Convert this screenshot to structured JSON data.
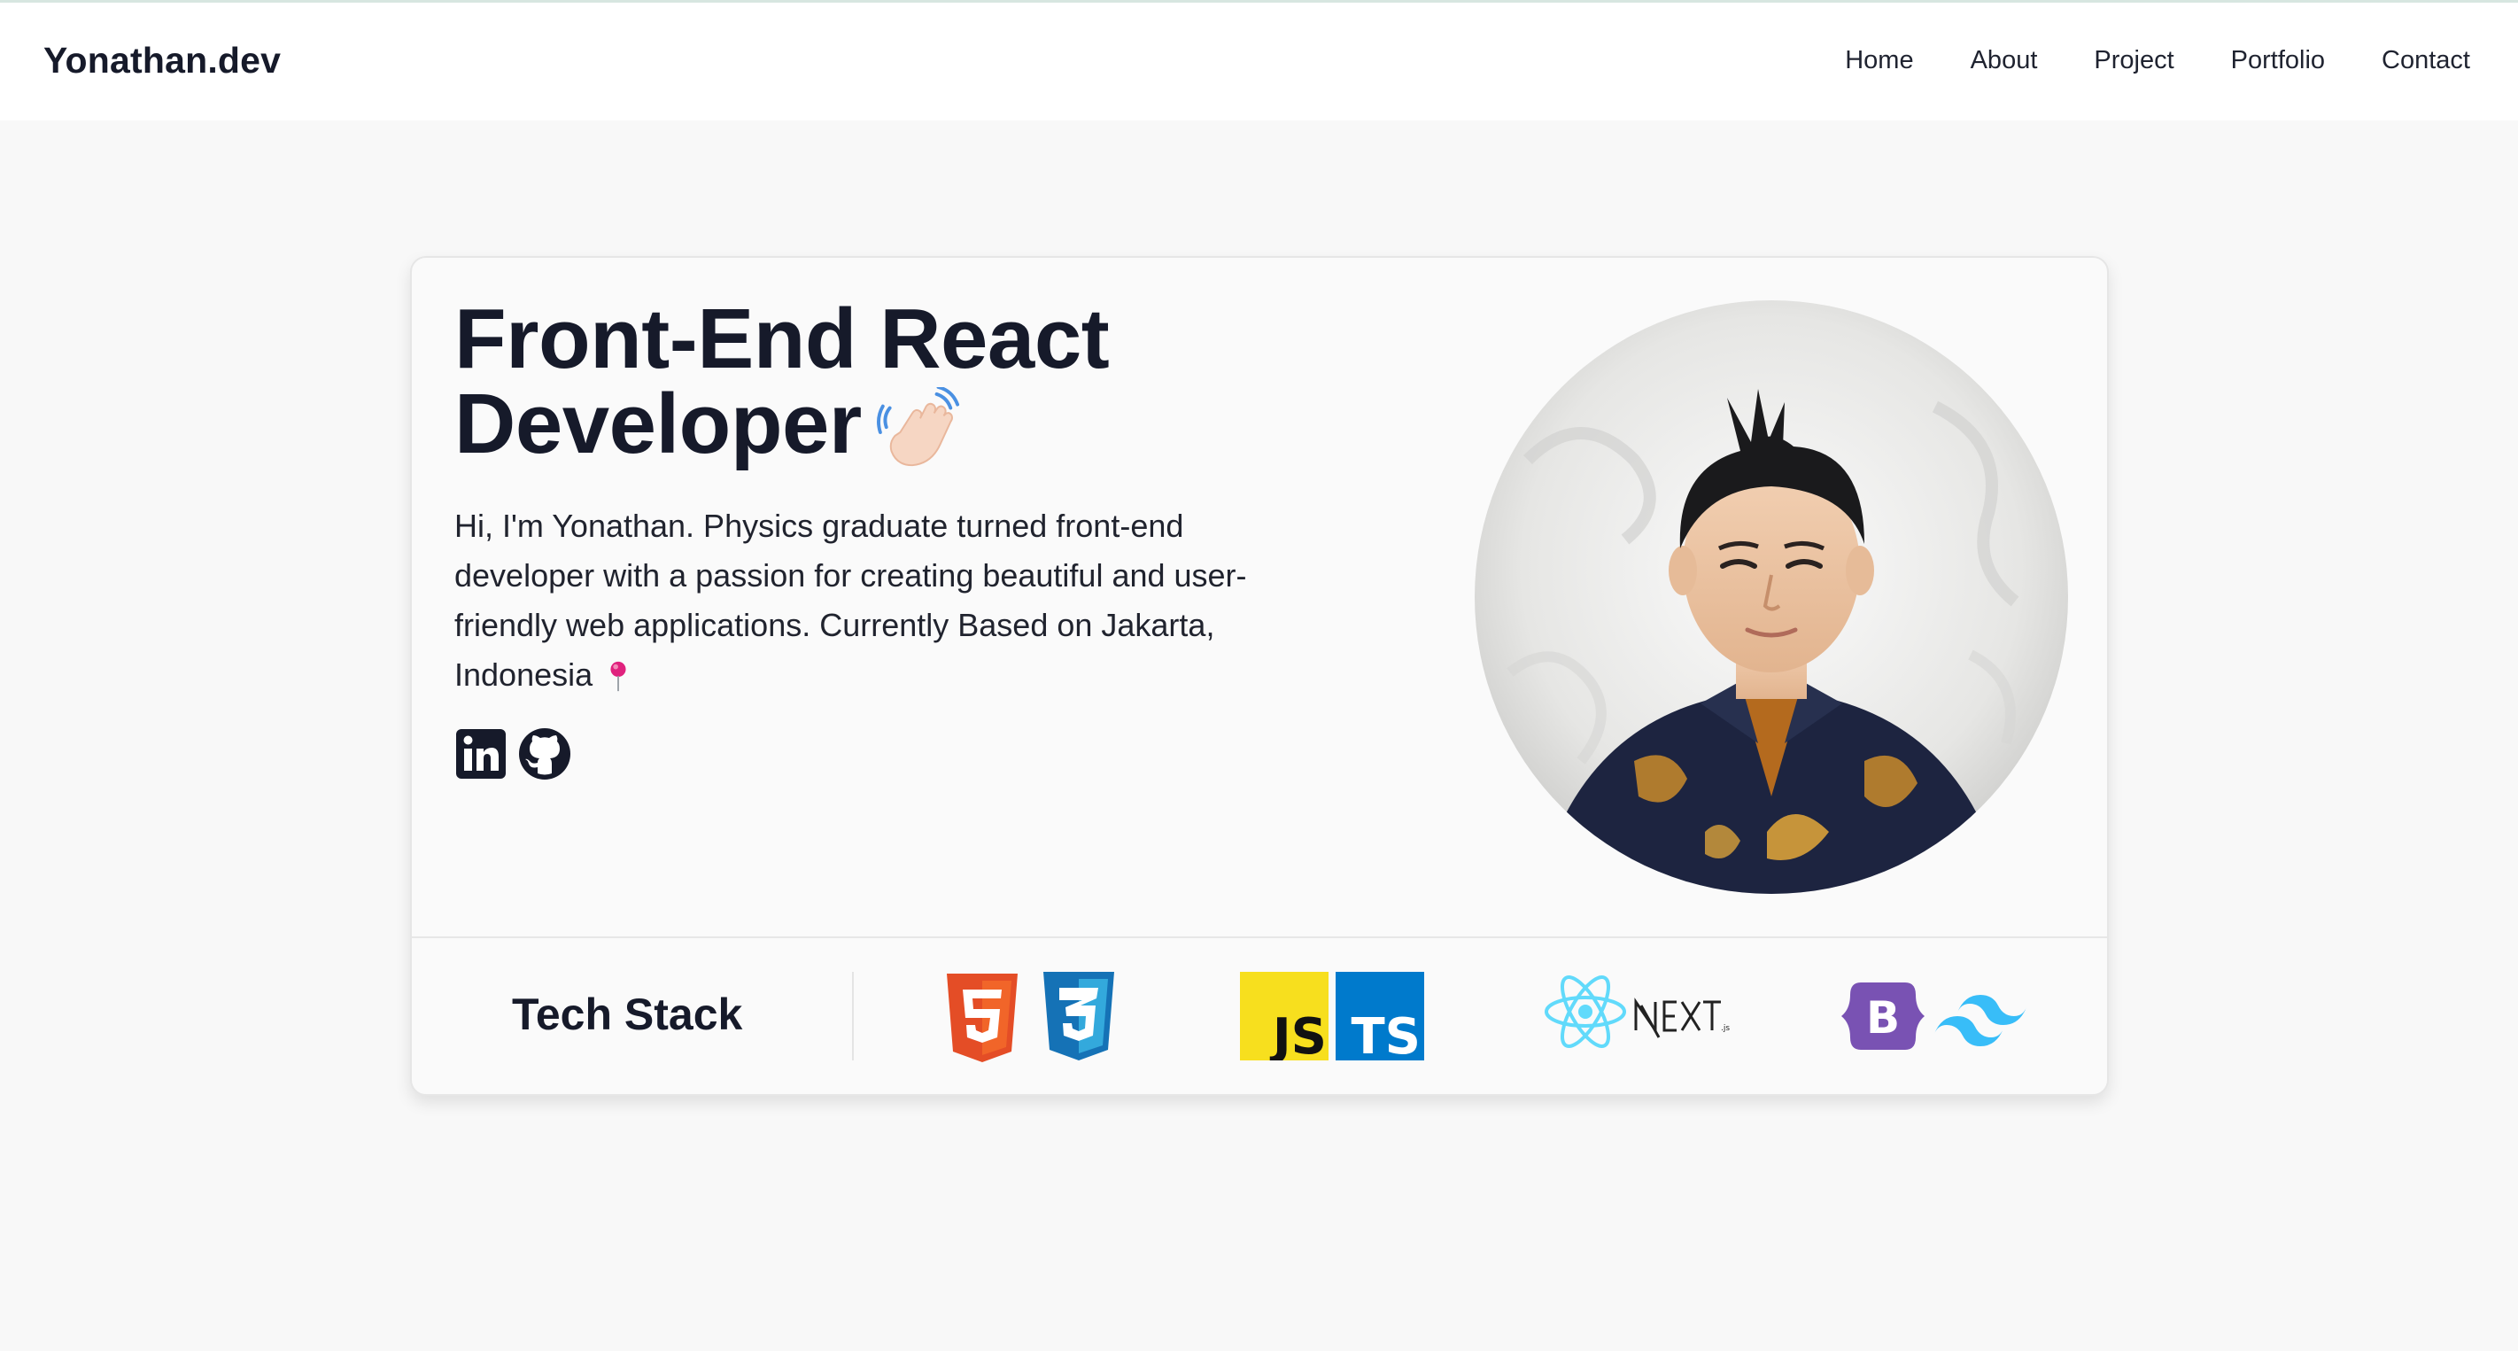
{
  "nav": {
    "brand": "Yonathan.dev",
    "links": [
      "Home",
      "About",
      "Project",
      "Portfolio",
      "Contact"
    ]
  },
  "hero": {
    "title_line1": "Front-End React",
    "title_line2": "Developer",
    "description": "Hi, I'm Yonathan. Physics graduate turned front-end developer with a passion for creating beautiful and user-friendly web applications. Currently Based on Jakarta, Indonesia",
    "emoji_icon": "waving-hand-icon",
    "location_icon": "round-pushpin-icon"
  },
  "socials": [
    {
      "name": "linkedin-icon"
    },
    {
      "name": "github-icon"
    }
  ],
  "tech_stack": {
    "label": "Tech Stack",
    "logos": [
      "html5",
      "css3",
      "javascript",
      "typescript",
      "react",
      "nextjs",
      "bootstrap",
      "tailwindcss"
    ]
  },
  "colors": {
    "page_bg": "#f8f8f8",
    "card_bg": "#fafafa",
    "text": "#161a2a",
    "html5": "#e44d26",
    "css3": "#1572b6",
    "javascript": "#f7df1e",
    "typescript": "#007acc",
    "react": "#61dafb",
    "bootstrap": "#7952b3",
    "tailwind": "#38bdf8"
  }
}
